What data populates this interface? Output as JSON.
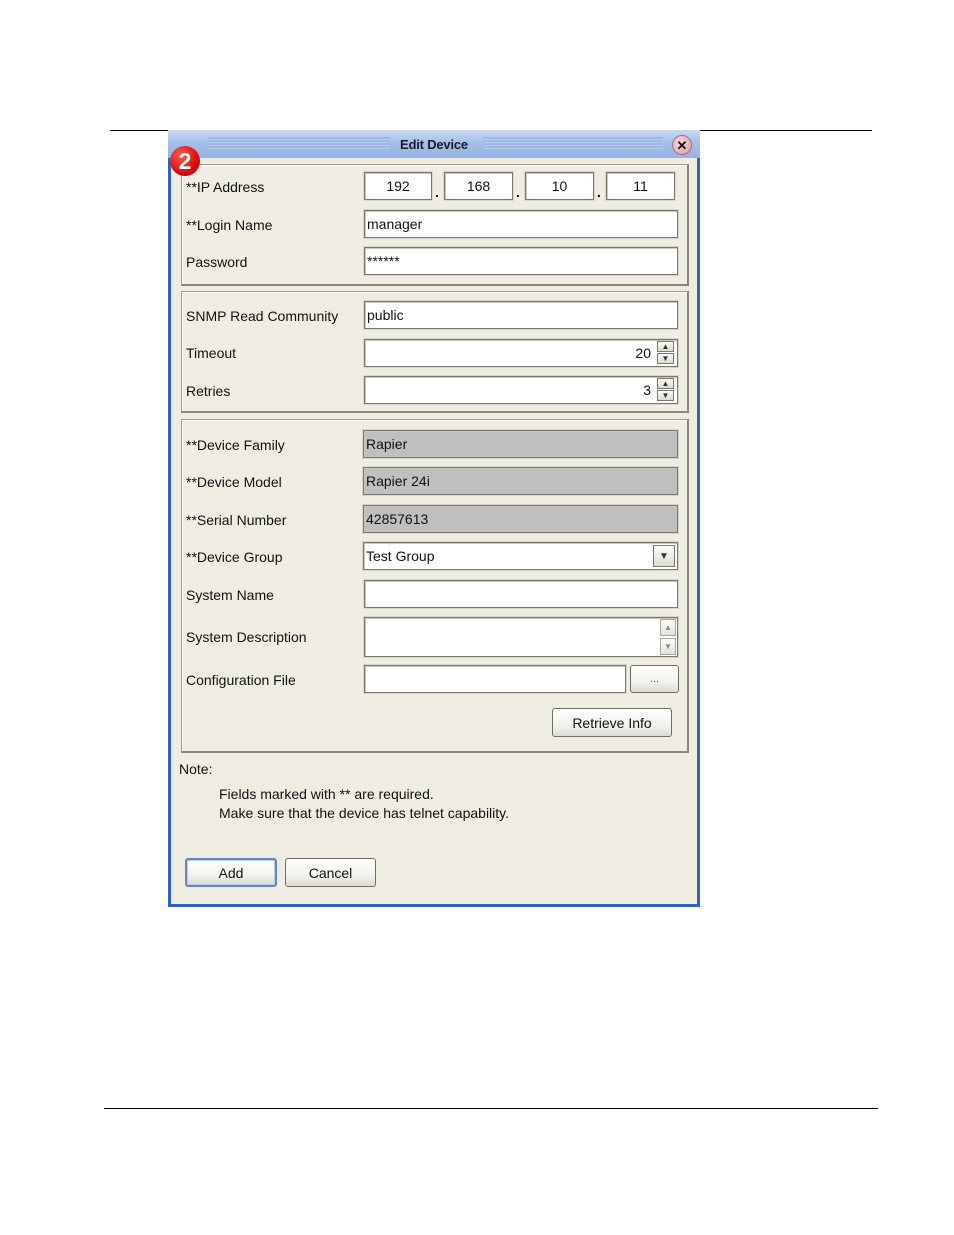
{
  "dialog": {
    "title": "Edit Device",
    "close_icon": "close-icon",
    "step_badge": "2"
  },
  "connection": {
    "ip_label": "**IP Address",
    "ip_octets": [
      "192",
      "168",
      "10",
      "11"
    ],
    "ip_separator": ".",
    "login_label": "**Login Name",
    "login_value": "manager",
    "password_label": "Password",
    "password_value": "******"
  },
  "snmp": {
    "community_label": "SNMP Read Community",
    "community_value": "public",
    "timeout_label": "Timeout",
    "timeout_value": "20",
    "retries_label": "Retries",
    "retries_value": "3"
  },
  "device": {
    "family_label": "**Device Family",
    "family_value": "Rapier",
    "model_label": "**Device Model",
    "model_value": "Rapier 24i",
    "serial_label": "**Serial Number",
    "serial_value": "42857613",
    "group_label": "**Device Group",
    "group_value": "Test Group",
    "sysname_label": "System Name",
    "sysname_value": "",
    "sysdesc_label": "System Description",
    "sysdesc_value": "",
    "config_label": "Configuration File",
    "config_value": "",
    "browse_label": "...",
    "retrieve_label": "Retrieve Info"
  },
  "note": {
    "heading": "Note:",
    "lines": [
      "Fields marked with ** are required.",
      "Make sure that the device has telnet capability."
    ]
  },
  "actions": {
    "add_label": "Add",
    "cancel_label": "Cancel"
  }
}
